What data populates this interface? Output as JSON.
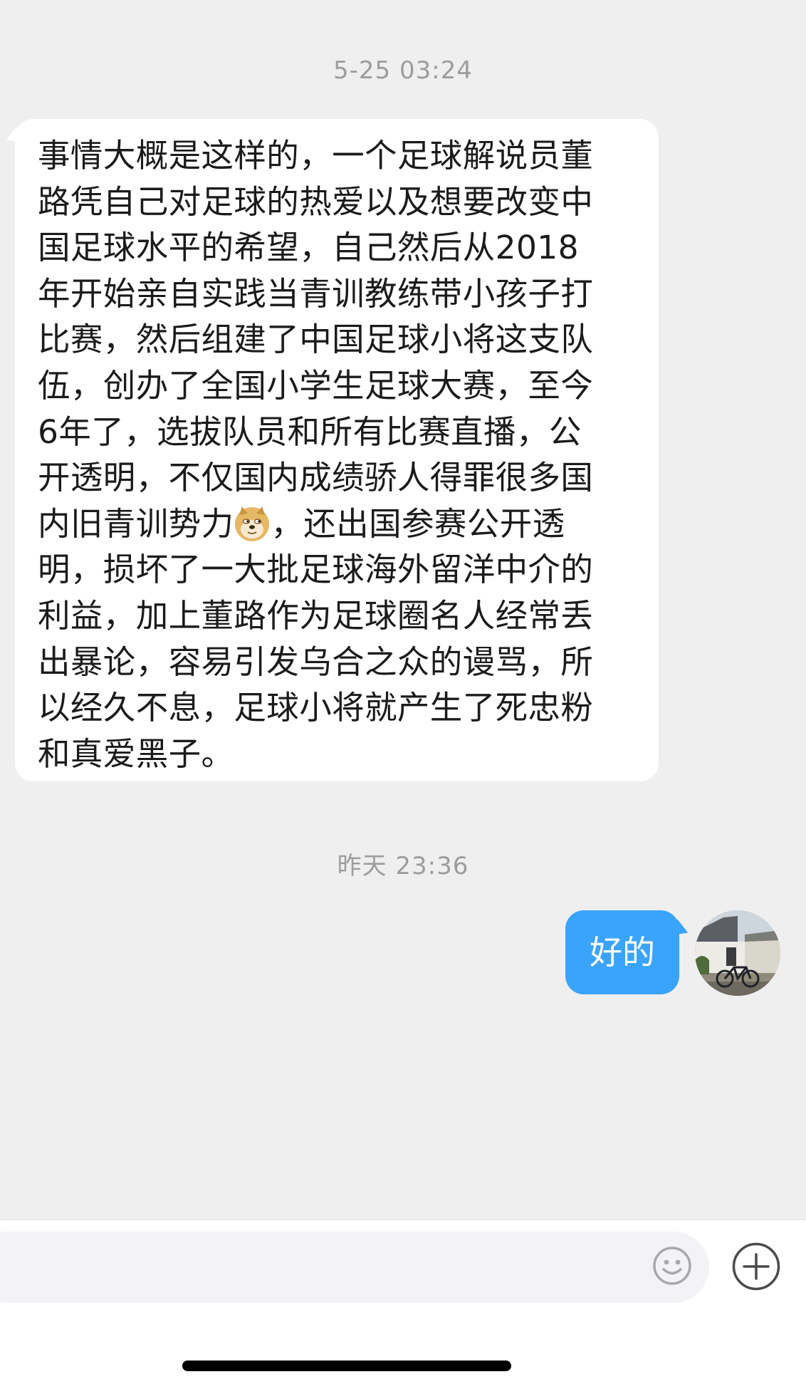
{
  "chat": {
    "timestamp_1": "5-25 03:24",
    "incoming_message": {
      "lines": [
        "事情大概是这样的，一个足球解说员董",
        "路凭自己对足球的热爱以及想要改变中",
        "国足球水平的希望，自己然后从2018",
        "年开始亲自实践当青训教练带小孩子打",
        "比赛，然后组建了中国足球小将这支队",
        "伍，创办了全国小学生足球大赛，至今",
        "6年了，选拔队员和所有比赛直播，公",
        "开透明，不仅国内成绩骄人得罪很多国"
      ],
      "line_with_emoji_before": "内旧青训势力",
      "line_with_emoji_after": "，还出国参赛公开透",
      "lines_after": [
        "明，损坏了一大批足球海外留洋中介的",
        "利益，加上董路作为足球圈名人经常丢",
        "出暴论，容易引发乌合之众的谩骂，所",
        "以经久不息，足球小将就产生了死忠粉",
        "和真爱黑子。"
      ],
      "emoji": "doge-emoji-icon"
    },
    "timestamp_2": "昨天 23:36",
    "outgoing_message": "好的",
    "avatar": "avatar-photo-house-bicycle"
  },
  "input_bar": {
    "placeholder": "",
    "emoji_icon": "smiley-icon",
    "plus_icon": "plus-circle-icon"
  },
  "colors": {
    "background": "#efeff0",
    "incoming_bubble": "#ffffff",
    "outgoing_bubble": "#3aa4fb",
    "timestamp_text": "#9c9c9f"
  }
}
